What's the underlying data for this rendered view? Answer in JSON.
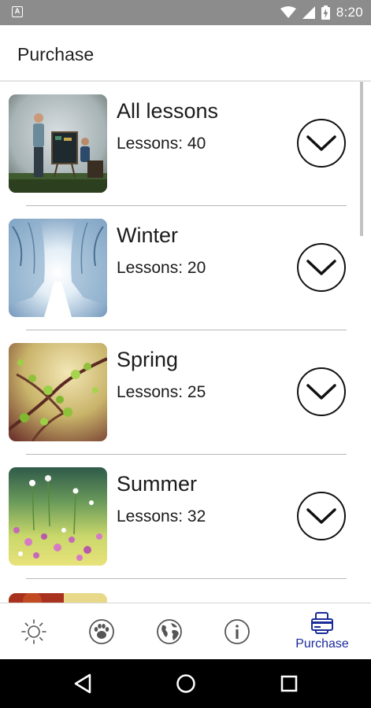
{
  "status_bar": {
    "app_indicator": "A",
    "time": "8:20",
    "icons": [
      "wifi-icon",
      "cellular-signal-icon",
      "battery-charging-icon"
    ]
  },
  "app_bar": {
    "title": "Purchase"
  },
  "lessons": [
    {
      "name": "All lessons",
      "count_text": "Lessons: 40",
      "image": "teacher-and-student-at-blackboard-thumbnail"
    },
    {
      "name": "Winter",
      "count_text": "Lessons: 20",
      "image": "snowy-forest-path-thumbnail"
    },
    {
      "name": "Spring",
      "count_text": "Lessons: 25",
      "image": "budding-branch-thumbnail"
    },
    {
      "name": "Summer",
      "count_text": "Lessons: 32",
      "image": "meadow-flowers-thumbnail"
    }
  ],
  "bottom_nav": {
    "items": [
      {
        "icon": "sun-icon",
        "label": ""
      },
      {
        "icon": "paw-icon",
        "label": ""
      },
      {
        "icon": "globe-icon",
        "label": ""
      },
      {
        "icon": "info-icon",
        "label": ""
      },
      {
        "icon": "purchase-card-icon",
        "label": "Purchase",
        "active": true
      }
    ]
  },
  "colors": {
    "status_bar": "#8c8c8c",
    "accent": "#1a2b9a",
    "divider": "#b8b8b8",
    "system_nav": "#000000"
  }
}
